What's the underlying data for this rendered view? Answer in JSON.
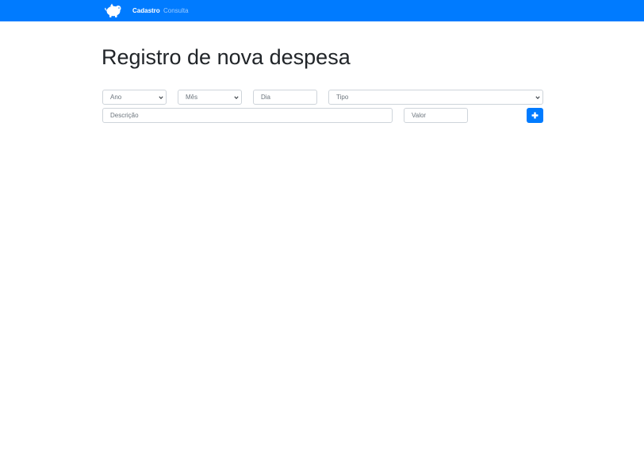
{
  "navbar": {
    "logo_icon": "piggy-bank-icon",
    "links": [
      {
        "label": "Cadastro",
        "active": true
      },
      {
        "label": "Consulta",
        "active": false
      }
    ]
  },
  "page": {
    "title": "Registro de nova despesa"
  },
  "form": {
    "ano": {
      "selected": "Ano"
    },
    "mes": {
      "selected": "Mês"
    },
    "dia": {
      "placeholder": "Dia"
    },
    "tipo": {
      "selected": "Tipo"
    },
    "descricao": {
      "placeholder": "Descrição"
    },
    "valor": {
      "placeholder": "Valor"
    },
    "add_button_icon": "plus-icon"
  },
  "colors": {
    "primary": "#007bff",
    "title_text": "#212529",
    "placeholder_text": "#6c757d",
    "field_border": "#ced4da"
  }
}
